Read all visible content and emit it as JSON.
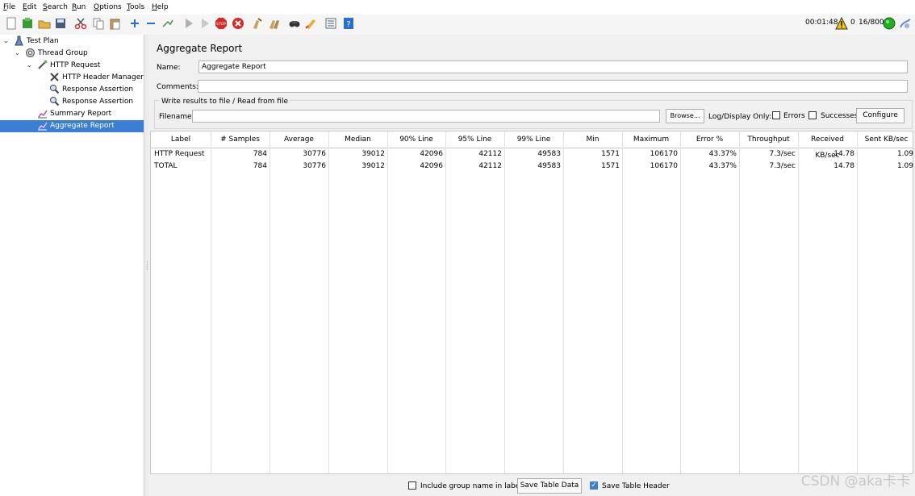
{
  "menu": [
    "File",
    "Edit",
    "Search",
    "Run",
    "Options",
    "Tools",
    "Help"
  ],
  "menu_mnemonic": [
    "F",
    "E",
    "S",
    "R",
    "O",
    "T",
    "H"
  ],
  "toolbar": {
    "icons": [
      "new-icon",
      "templates-icon",
      "open-icon",
      "save-icon",
      "cut-icon",
      "copy-icon",
      "paste-icon",
      "expand-icon",
      "collapse-icon",
      "toggle-icon",
      "start-icon",
      "start-no-pause-icon",
      "stop-icon",
      "shutdown-icon",
      "clear-icon",
      "clear-all-icon",
      "search-icon",
      "reset-search-icon",
      "function-helper-icon",
      "help-icon"
    ],
    "elapsed": "00:01:48",
    "warnings": "0",
    "threads": "16/800"
  },
  "tree": {
    "nodes": [
      {
        "label": "Test Plan",
        "icon": "test-plan-icon"
      },
      {
        "label": "Thread Group",
        "icon": "thread-group-icon"
      },
      {
        "label": "HTTP Request",
        "icon": "http-request-icon"
      },
      {
        "label": "HTTP Header Manager",
        "icon": "header-manager-icon"
      },
      {
        "label": "Response Assertion",
        "icon": "assertion-icon"
      },
      {
        "label": "Response Assertion",
        "icon": "assertion-icon"
      },
      {
        "label": "Summary Report",
        "icon": "report-icon"
      },
      {
        "label": "Aggregate Report",
        "icon": "report-icon",
        "selected": true
      }
    ]
  },
  "panel": {
    "title": "Aggregate Report",
    "name_label": "Name:",
    "name_value": "Aggregate Report",
    "comments_label": "Comments:",
    "comments_value": "",
    "write_results_legend": "Write results to file / Read from file",
    "filename_label": "Filename",
    "filename_value": "",
    "browse_label": "Browse...",
    "log_display_label": "Log/Display Only:",
    "errors_label": "Errors",
    "successes_label": "Successes",
    "configure_label": "Configure"
  },
  "table": {
    "columns": [
      "Label",
      "# Samples",
      "Average",
      "Median",
      "90% Line",
      "95% Line",
      "99% Line",
      "Min",
      "Maximum",
      "Error %",
      "Throughput",
      "Received KB/sec",
      "Sent KB/sec"
    ],
    "rows": [
      [
        "HTTP Request",
        "784",
        "30776",
        "39012",
        "42096",
        "42112",
        "49583",
        "1571",
        "106170",
        "43.37%",
        "7.3/sec",
        "14.78",
        "1.09"
      ],
      [
        "TOTAL",
        "784",
        "30776",
        "39012",
        "42096",
        "42112",
        "49583",
        "1571",
        "106170",
        "43.37%",
        "7.3/sec",
        "14.78",
        "1.09"
      ]
    ]
  },
  "footer": {
    "include_group_label": "Include group name in label?",
    "include_group_checked": false,
    "save_table_data_label": "Save Table Data",
    "save_table_header_label": "Save Table Header",
    "save_table_header_checked": true
  },
  "watermark": "CSDN @aka卡卡"
}
